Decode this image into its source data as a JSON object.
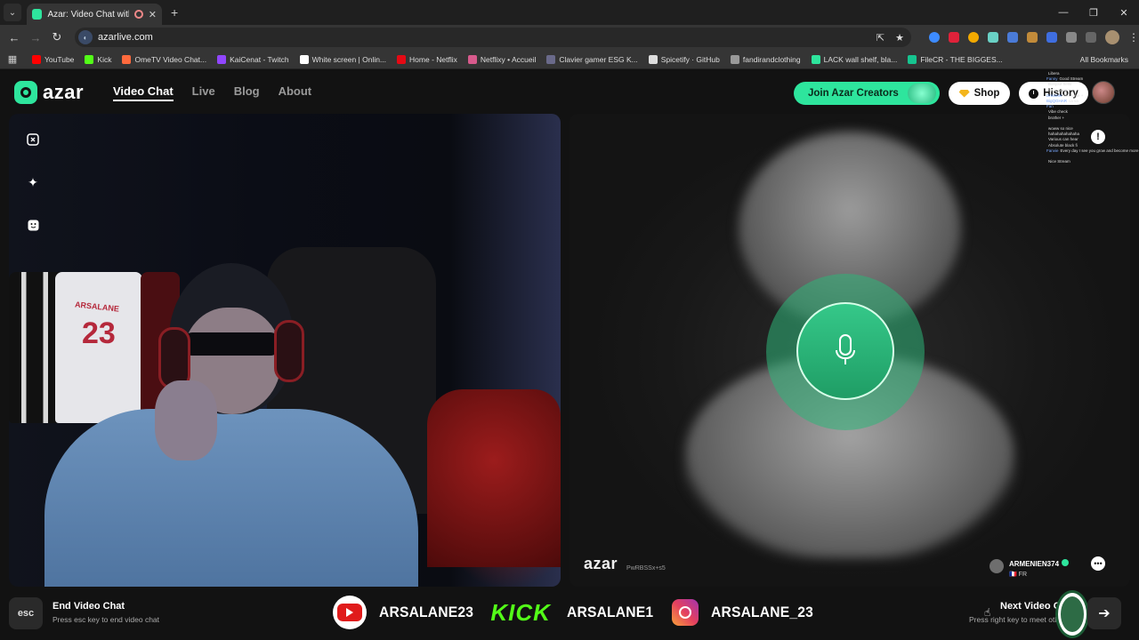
{
  "browser": {
    "tab_title": "Azar: Video Chat with New",
    "url": "azarlive.com",
    "bookmarks": [
      {
        "label": "YouTube",
        "color": "#ff0000"
      },
      {
        "label": "Kick",
        "color": "#53fc18"
      },
      {
        "label": "OmeTV Video Chat...",
        "color": "#ff6a3d"
      },
      {
        "label": "KaiCenat - Twitch",
        "color": "#9146ff"
      },
      {
        "label": "White screen | Onlin...",
        "color": "#ffffff"
      },
      {
        "label": "Home - Netflix",
        "color": "#e50914"
      },
      {
        "label": "Netflixy • Accueil",
        "color": "#d85a8c"
      },
      {
        "label": "Clavier gamer ESG K...",
        "color": "#6a6a8a"
      },
      {
        "label": "Spicetify · GitHub",
        "color": "#dddddd"
      },
      {
        "label": "fandirandclothing",
        "color": "#999999"
      },
      {
        "label": "LACK wall shelf, bla...",
        "color": "#2ee59d"
      },
      {
        "label": "FileCR - THE BIGGES...",
        "color": "#16c48f"
      }
    ],
    "all_bookmarks": "All Bookmarks"
  },
  "header": {
    "logo": "azar",
    "nav": [
      "Video Chat",
      "Live",
      "Blog",
      "About"
    ],
    "creators": "Join Azar Creators",
    "shop": "Shop",
    "history": "History"
  },
  "right_video": {
    "watermark": "azar",
    "session_id": "PwRBSSx+s5",
    "peer_name": "ARMENIEN374",
    "peer_country": "FR"
  },
  "left_video": {
    "jersey_name": "ARSALANE",
    "jersey_number": "23"
  },
  "stream_chat": [
    {
      "user": "",
      "text": "Libera"
    },
    {
      "user": "Fanny",
      "text": "Good Stream"
    },
    {
      "user": "",
      "text": "Bonjour hello"
    },
    {
      "user": "",
      "text": "Nice stream"
    },
    {
      "user": "Dreamer",
      "text": "this hype +"
    },
    {
      "user": "BigQGHAR",
      "text": "ca va"
    },
    {
      "user": "Fan",
      "text": ""
    },
    {
      "user": "",
      "text": "Vibe check"
    },
    {
      "user": "",
      "text": "brother +"
    },
    {
      "user": "",
      "text": ""
    },
    {
      "user": "",
      "text": "woww so nice"
    },
    {
      "user": "",
      "text": "hahahahahahaha"
    },
    {
      "user": "",
      "text": "Various can hear"
    },
    {
      "user": "",
      "text": "Absolute black fi"
    },
    {
      "user": "Fanvie",
      "text": "Every day I see you grow and become more beautiful"
    },
    {
      "user": "",
      "text": ""
    },
    {
      "user": "",
      "text": "Nice Stream"
    }
  ],
  "bottom": {
    "esc_key": "esc",
    "end_title": "End Video Chat",
    "end_desc": "Press esc key to end video chat",
    "youtube_name": "ARSALANE23",
    "kick_logo": "KICK",
    "kick_name": "ARSALANE1",
    "instagram_name": "ARSALANE_23",
    "next_title": "Next Video Chat",
    "next_desc": "Press right key to meet others"
  },
  "colors": {
    "accent": "#2ee59d",
    "background": "#121212"
  }
}
